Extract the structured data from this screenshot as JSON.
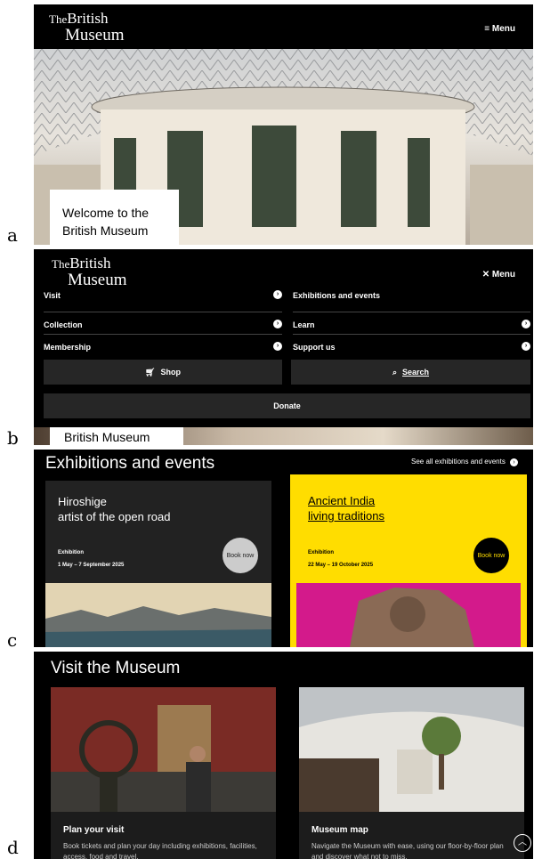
{
  "labels": [
    "a",
    "b",
    "c",
    "d"
  ],
  "logo": {
    "the": "The",
    "british": "British",
    "museum": "Museum"
  },
  "panel_a": {
    "menu": "Menu",
    "welcome": "Welcome to the British Museum"
  },
  "panel_b": {
    "menu": "Menu",
    "nav_left": [
      "Visit",
      "Collection",
      "Membership"
    ],
    "nav_right": [
      "Exhibitions and events",
      "Learn",
      "Support us"
    ],
    "shop": "Shop",
    "search": "Search",
    "donate": "Donate",
    "peek_text": "British Museum"
  },
  "panel_c": {
    "heading": "Exhibitions and events",
    "see_all": "See all exhibitions and events",
    "cards": [
      {
        "title_line1": "Hiroshige",
        "title_line2": "artist of the open road",
        "type": "Exhibition",
        "dates": "1 May – 7 September 2025",
        "cta": "Book now",
        "bg": "#222222"
      },
      {
        "title_line1": "Ancient India",
        "title_line2": "living traditions",
        "type": "Exhibition",
        "dates": "22 May – 19 October 2025",
        "cta": "Book now",
        "bg": "#ffdd00"
      }
    ]
  },
  "panel_d": {
    "heading": "Visit the Museum",
    "cards": [
      {
        "title": "Plan your visit",
        "desc": "Book tickets and plan your day including exhibitions, facilities, access, food and travel."
      },
      {
        "title": "Museum map",
        "desc": "Navigate the Museum with ease, using our floor-by-floor plan and discover what not to miss."
      }
    ]
  }
}
